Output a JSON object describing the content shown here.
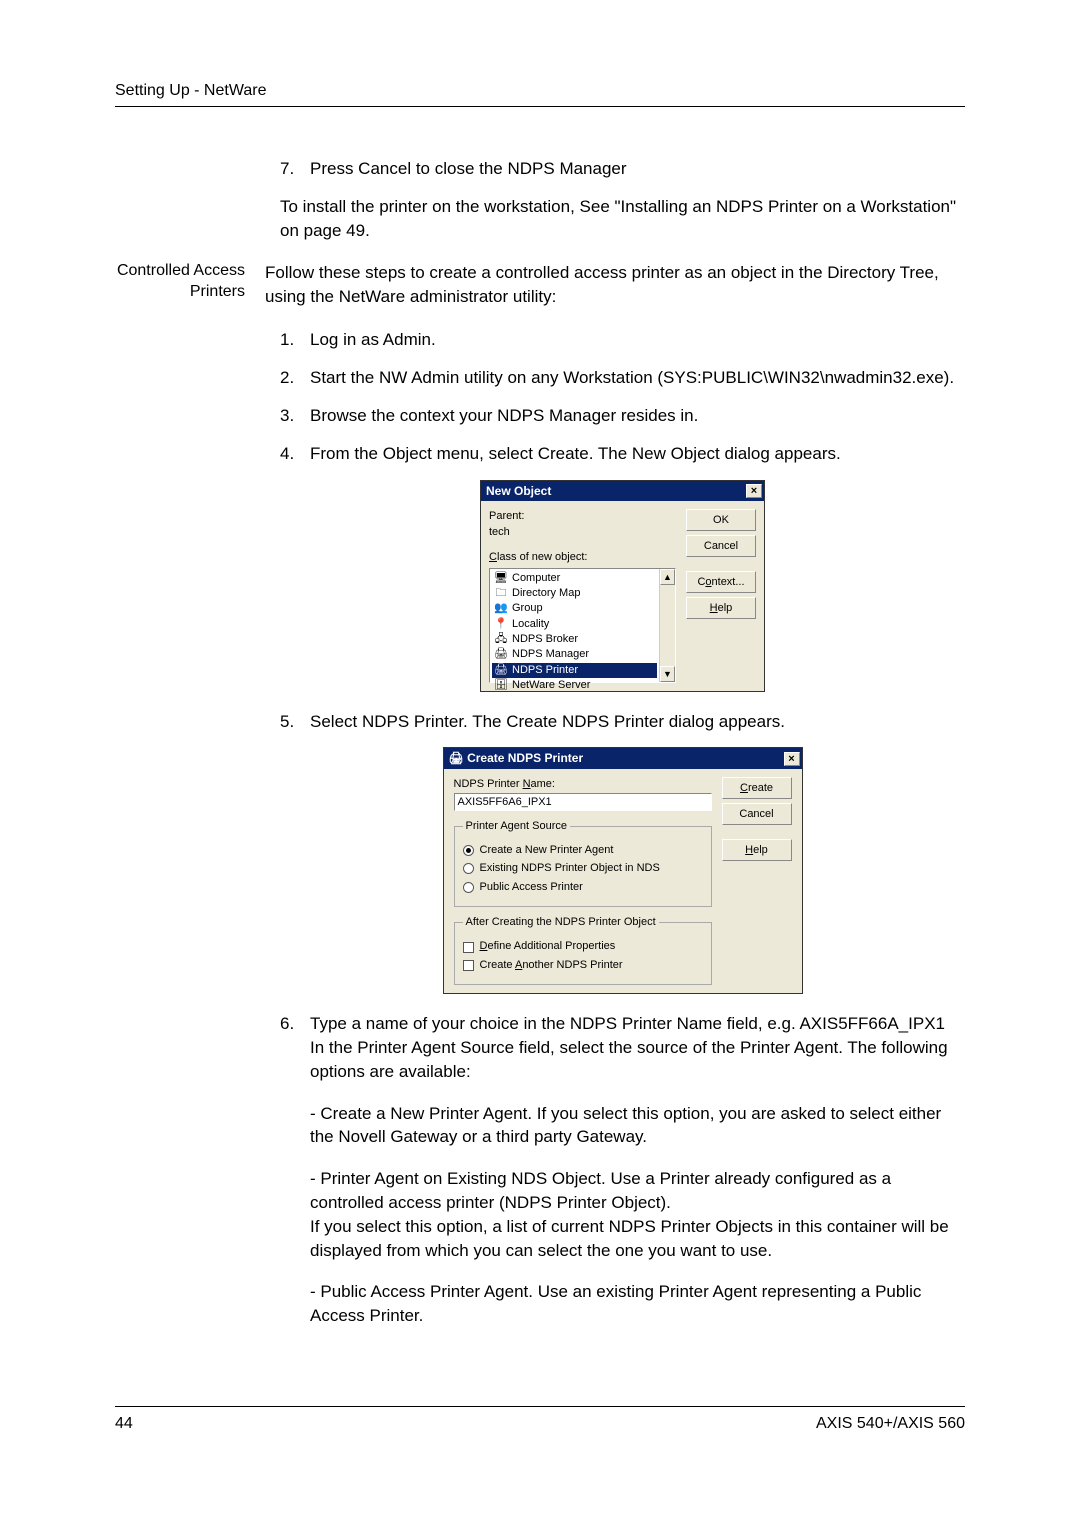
{
  "header": {
    "section": "Setting Up - NetWare"
  },
  "intro": {
    "step7_num": "7.",
    "step7_text": "Press Cancel to close the NDPS Manager",
    "install_note": "To install the printer on the workstation, See \"Installing an NDPS Printer on a Workstation\" on page 49."
  },
  "sidebar": {
    "line1": "Controlled Access",
    "line2": "Printers"
  },
  "controlled": {
    "intro": "Follow these steps to create a controlled access printer as an object in the Directory Tree, using the NetWare administrator utility:",
    "steps": {
      "s1n": "1.",
      "s1": "Log in as Admin.",
      "s2n": "2.",
      "s2": "Start the NW Admin utility on any Workstation (SYS:PUBLIC\\WIN32\\nwadmin32.exe).",
      "s3n": "3.",
      "s3": "Browse the context your NDPS Manager resides in.",
      "s4n": "4.",
      "s4": "From the Object menu, select Create. The New Object dialog appears.",
      "s5n": "5.",
      "s5": "Select NDPS Printer. The Create NDPS Printer dialog appears.",
      "s6n": "6.",
      "s6a": "Type a name of your choice in the NDPS Printer Name field, e.g. AXIS5FF66A_IPX1",
      "s6b": "In the Printer Agent Source field, select the source of the Printer Agent. The following options are available:",
      "opt1": "- Create a New Printer Agent. If you select this option, you are asked to select either the Novell Gateway or a third party Gateway.",
      "opt2a": "- Printer Agent on Existing NDS Object. Use a Printer already configured as a controlled access printer (NDPS Printer Object).",
      "opt2b": "If you select this option, a list of current NDPS Printer Objects in this container will be displayed from which you can select the one you want to use.",
      "opt3": "- Public Access Printer Agent. Use an existing Printer Agent representing a Public Access Printer."
    }
  },
  "dialog1": {
    "title": "New Object",
    "parent_label": "Parent:",
    "parent_value": "tech",
    "class_label": "Class of new object:",
    "items": [
      "Computer",
      "Directory Map",
      "Group",
      "Locality",
      "NDPS Broker",
      "NDPS Manager",
      "NDPS Printer",
      "NetWare Server"
    ],
    "btns": {
      "ok": "OK",
      "cancel": "Cancel",
      "context": "Context...",
      "help": "Help"
    }
  },
  "dialog2": {
    "title": "Create NDPS Printer",
    "name_label": "NDPS Printer Name:",
    "name_value": "AXIS5FF6A6_IPX1",
    "pas_legend": "Printer Agent Source",
    "r1": "Create a New Printer Agent",
    "r2": "Existing NDPS Printer Object in NDS",
    "r3": "Public Access Printer",
    "after_legend": "After Creating the NDPS Printer Object",
    "c1": "Define Additional Properties",
    "c2": "Create Another NDPS Printer",
    "btns": {
      "create": "Create",
      "cancel": "Cancel",
      "help": "Help"
    }
  },
  "footer": {
    "page": "44",
    "doc": "AXIS 540+/AXIS 560"
  }
}
